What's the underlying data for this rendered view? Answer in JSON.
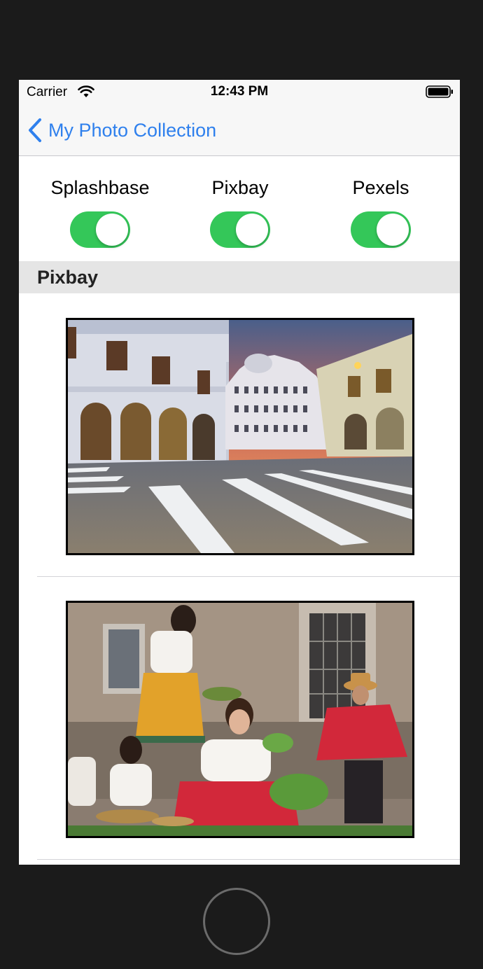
{
  "status_bar": {
    "carrier": "Carrier",
    "time": "12:43 PM"
  },
  "nav": {
    "back_label": "My Photo Collection"
  },
  "toggles": [
    {
      "label": "Splashbase",
      "on": true
    },
    {
      "label": "Pixbay",
      "on": true
    },
    {
      "label": "Pexels",
      "on": true
    }
  ],
  "section": {
    "title": "Pixbay"
  },
  "photos": [
    {
      "subject": "colonial-street-crosswalk-sunset"
    },
    {
      "subject": "festival-parade-traditional-dress"
    }
  ],
  "colors": {
    "accent": "#2f80ed",
    "switch_on": "#34c759",
    "section_bg": "#e5e5e5"
  }
}
